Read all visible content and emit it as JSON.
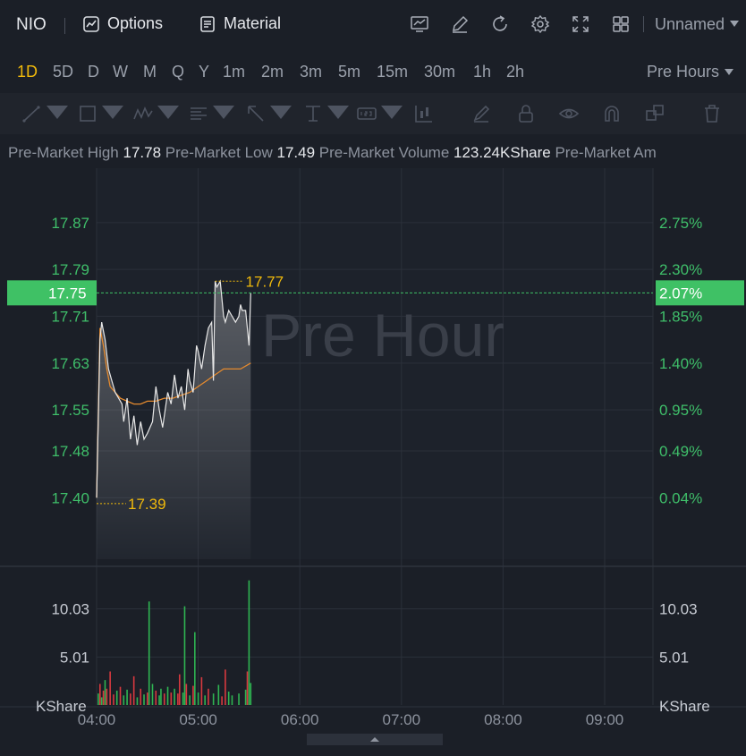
{
  "toolbar": {
    "ticker": "NIO",
    "options_label": "Options",
    "material_label": "Material",
    "layout_name": "Unnamed",
    "icons": [
      "chart-indicator-icon",
      "draw-icon",
      "refresh-icon",
      "settings-icon",
      "fullscreen-icon",
      "layout-grid-icon"
    ]
  },
  "periods": {
    "items": [
      "1D",
      "5D",
      "D",
      "W",
      "M",
      "Q",
      "Y",
      "1m",
      "2m",
      "3m",
      "5m",
      "15m",
      "30m",
      "1h",
      "2h"
    ],
    "active": "1D",
    "session_label": "Pre Hours"
  },
  "drawing_tools": [
    "line-tool-icon",
    "rectangle-tool-icon",
    "pattern-tool-icon",
    "fib-tool-icon",
    "arrow-tool-icon",
    "measure-tool-icon",
    "text-tool-icon",
    "indicator-tool-icon",
    "brush-tool-icon",
    "lock-icon",
    "eye-icon",
    "magnet-icon",
    "clone-icon",
    "trash-icon"
  ],
  "stats": [
    {
      "label": "Pre-Market High",
      "value": "17.78"
    },
    {
      "label": "Pre-Market Low",
      "value": "17.49"
    },
    {
      "label": "Pre-Market Volume",
      "value": "123.24KShare"
    },
    {
      "label": "Pre-Market Am",
      "value": ""
    }
  ],
  "colors": {
    "background": "#1b1f27",
    "grid": "#2b303a",
    "price_line": "#e8e8e8",
    "avg_line": "#e58a2e",
    "axis_green": "#3fbf6a",
    "last_price_bg": "#3fc165",
    "marker_yellow": "#f0b90b",
    "volume_up": "#2fb552",
    "volume_down": "#d8393f"
  },
  "chart_data": {
    "type": "line",
    "watermark": "Pre Hour",
    "x_ticks": [
      "04:00",
      "05:00",
      "06:00",
      "07:00",
      "08:00",
      "09:00"
    ],
    "price_ticks": [
      "17.87",
      "17.79",
      "17.71",
      "17.63",
      "17.55",
      "17.48",
      "17.40"
    ],
    "percent_ticks": [
      "2.75%",
      "2.30%",
      "1.85%",
      "1.40%",
      "0.95%",
      "0.49%",
      "0.04%"
    ],
    "ylim": [
      17.295,
      17.963
    ],
    "x_range_minutes": [
      0,
      330
    ],
    "last_price": "17.75",
    "last_percent": "2.07%",
    "last_value": 17.75,
    "high_marker": {
      "label": "17.77",
      "minute": 70,
      "value": 17.77
    },
    "low_marker": {
      "label": "17.39",
      "minute": 0,
      "value": 17.39
    },
    "series": [
      {
        "points": [
          [
            0,
            17.4
          ],
          [
            2,
            17.67
          ],
          [
            3,
            17.7
          ],
          [
            5,
            17.67
          ],
          [
            7,
            17.62
          ],
          [
            9,
            17.6
          ],
          [
            11,
            17.58
          ],
          [
            13,
            17.57
          ],
          [
            15,
            17.56
          ],
          [
            16,
            17.53
          ],
          [
            18,
            17.57
          ],
          [
            20,
            17.5
          ],
          [
            22,
            17.54
          ],
          [
            24,
            17.49
          ],
          [
            26,
            17.53
          ],
          [
            28,
            17.5
          ],
          [
            30,
            17.51
          ],
          [
            33,
            17.53
          ],
          [
            35,
            17.59
          ],
          [
            37,
            17.55
          ],
          [
            39,
            17.52
          ],
          [
            42,
            17.58
          ],
          [
            44,
            17.56
          ],
          [
            46,
            17.61
          ],
          [
            48,
            17.57
          ],
          [
            50,
            17.59
          ],
          [
            52,
            17.55
          ],
          [
            54,
            17.62
          ],
          [
            55,
            17.6
          ],
          [
            57,
            17.58
          ],
          [
            59,
            17.66
          ],
          [
            60,
            17.65
          ],
          [
            62,
            17.62
          ],
          [
            64,
            17.66
          ],
          [
            66,
            17.69
          ],
          [
            68,
            17.7
          ],
          [
            69,
            17.6
          ],
          [
            70,
            17.77
          ],
          [
            71,
            17.76
          ],
          [
            73,
            17.77
          ],
          [
            75,
            17.71
          ],
          [
            76,
            17.7
          ],
          [
            78,
            17.72
          ],
          [
            80,
            17.71
          ],
          [
            82,
            17.7
          ],
          [
            84,
            17.71
          ],
          [
            85,
            17.73
          ],
          [
            86,
            17.72
          ],
          [
            88,
            17.72
          ],
          [
            90,
            17.66
          ],
          [
            91,
            17.75
          ]
        ]
      },
      {
        "points": [
          [
            0,
            17.4
          ],
          [
            2,
            17.69
          ],
          [
            4,
            17.66
          ],
          [
            6,
            17.62
          ],
          [
            8,
            17.59
          ],
          [
            11,
            17.58
          ],
          [
            14,
            17.57
          ],
          [
            18,
            17.565
          ],
          [
            22,
            17.56
          ],
          [
            26,
            17.56
          ],
          [
            30,
            17.565
          ],
          [
            35,
            17.565
          ],
          [
            40,
            17.57
          ],
          [
            45,
            17.57
          ],
          [
            50,
            17.575
          ],
          [
            55,
            17.58
          ],
          [
            60,
            17.59
          ],
          [
            65,
            17.6
          ],
          [
            70,
            17.61
          ],
          [
            75,
            17.62
          ],
          [
            80,
            17.62
          ],
          [
            85,
            17.62
          ],
          [
            91,
            17.63
          ]
        ]
      }
    ],
    "volume": {
      "axis_label": "KShare",
      "ticks": [
        "10.03",
        "5.01"
      ],
      "ylim": [
        0,
        14
      ],
      "bars": [
        [
          1,
          1.2,
          "up"
        ],
        [
          2,
          2.2,
          "down"
        ],
        [
          3,
          0.8,
          "up"
        ],
        [
          4,
          1.5,
          "down"
        ],
        [
          5,
          2.6,
          "up"
        ],
        [
          6,
          1.7,
          "down"
        ],
        [
          8,
          3.5,
          "down"
        ],
        [
          10,
          1.1,
          "down"
        ],
        [
          12,
          1.5,
          "up"
        ],
        [
          14,
          1.9,
          "down"
        ],
        [
          16,
          1.0,
          "up"
        ],
        [
          18,
          1.6,
          "up"
        ],
        [
          20,
          1.2,
          "down"
        ],
        [
          22,
          3.0,
          "down"
        ],
        [
          24,
          0.8,
          "up"
        ],
        [
          26,
          1.7,
          "down"
        ],
        [
          28,
          1.1,
          "up"
        ],
        [
          30,
          1.3,
          "down"
        ],
        [
          31,
          10.8,
          "up"
        ],
        [
          33,
          2.2,
          "up"
        ],
        [
          35,
          1.5,
          "down"
        ],
        [
          37,
          1.0,
          "up"
        ],
        [
          38,
          1.7,
          "up"
        ],
        [
          40,
          1.2,
          "down"
        ],
        [
          42,
          1.9,
          "up"
        ],
        [
          44,
          1.3,
          "down"
        ],
        [
          46,
          1.7,
          "up"
        ],
        [
          48,
          1.2,
          "down"
        ],
        [
          49,
          3.2,
          "down"
        ],
        [
          51,
          1.3,
          "up"
        ],
        [
          52,
          10.3,
          "up"
        ],
        [
          53,
          2.2,
          "down"
        ],
        [
          55,
          1.0,
          "up"
        ],
        [
          57,
          2.0,
          "down"
        ],
        [
          58,
          7.6,
          "up"
        ],
        [
          60,
          1.3,
          "up"
        ],
        [
          62,
          2.9,
          "down"
        ],
        [
          64,
          1.0,
          "up"
        ],
        [
          66,
          1.7,
          "down"
        ],
        [
          69,
          1.2,
          "up"
        ],
        [
          72,
          2.1,
          "up"
        ],
        [
          74,
          0.9,
          "down"
        ],
        [
          76,
          3.7,
          "down"
        ],
        [
          78,
          1.4,
          "up"
        ],
        [
          80,
          1.0,
          "up"
        ],
        [
          84,
          1.2,
          "up"
        ],
        [
          88,
          1.6,
          "up"
        ],
        [
          89,
          3.5,
          "down"
        ],
        [
          90,
          13.0,
          "up"
        ],
        [
          91,
          2.3,
          "up"
        ]
      ]
    }
  }
}
